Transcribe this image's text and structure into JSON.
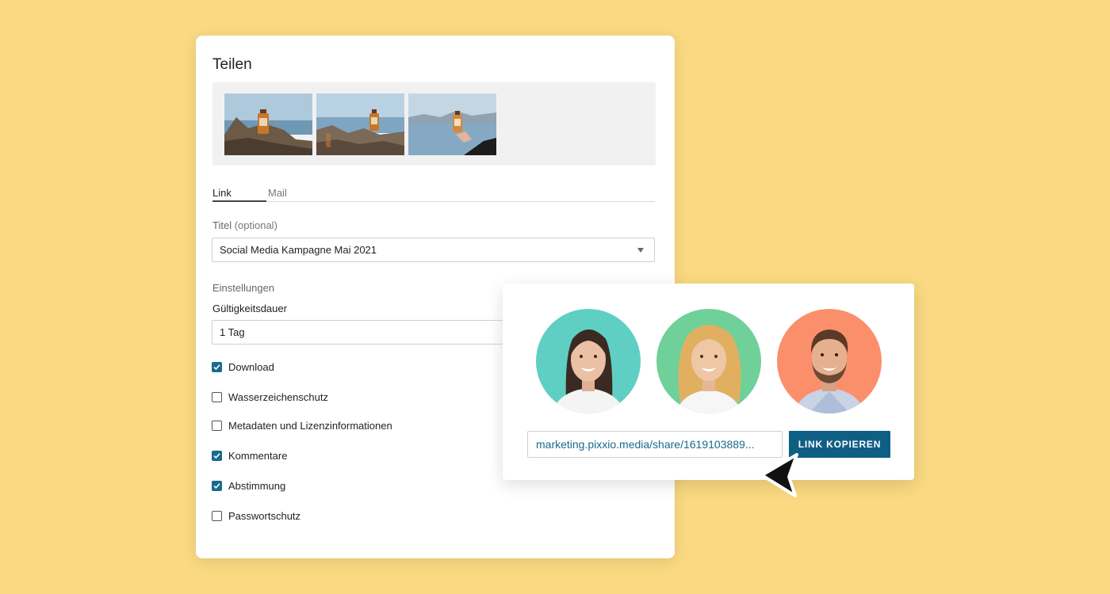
{
  "share_dialog": {
    "title": "Teilen",
    "thumbnails": [
      "photo-bottle-cliff-1",
      "photo-bottle-cliff-2",
      "photo-bottle-hand"
    ],
    "tabs": [
      {
        "label": "Link",
        "active": true
      },
      {
        "label": "Mail",
        "active": false
      }
    ],
    "title_field": {
      "label": "Titel",
      "optional": "(optional)",
      "value": "Social Media Kampagne Mai 2021"
    },
    "settings": {
      "heading": "Einstellungen",
      "validity_label": "Gültigkeitsdauer",
      "validity_value": "1 Tag",
      "options": [
        {
          "label": "Download",
          "checked": true
        },
        {
          "label": "Wasserzeichenschutz",
          "checked": false
        },
        {
          "label": "Metadaten und Lizenzinformationen",
          "checked": false
        },
        {
          "label": "Kommentare",
          "checked": true
        },
        {
          "label": "Abstimmung",
          "checked": true
        },
        {
          "label": "Passwortschutz",
          "checked": false
        }
      ]
    }
  },
  "share_popup": {
    "avatars": [
      {
        "name": "avatar-woman-dark-hair",
        "bg": "#5fcfc4"
      },
      {
        "name": "avatar-woman-blonde",
        "bg": "#6fd09a"
      },
      {
        "name": "avatar-man-beard",
        "bg": "#fb8f6c"
      }
    ],
    "link_value": "marketing.pixxio.media/share/1619103889...",
    "copy_button": "LINK KOPIEREN"
  },
  "colors": {
    "background": "#fad982",
    "accent": "#0f5f85",
    "checkbox": "#1a6a8c"
  }
}
